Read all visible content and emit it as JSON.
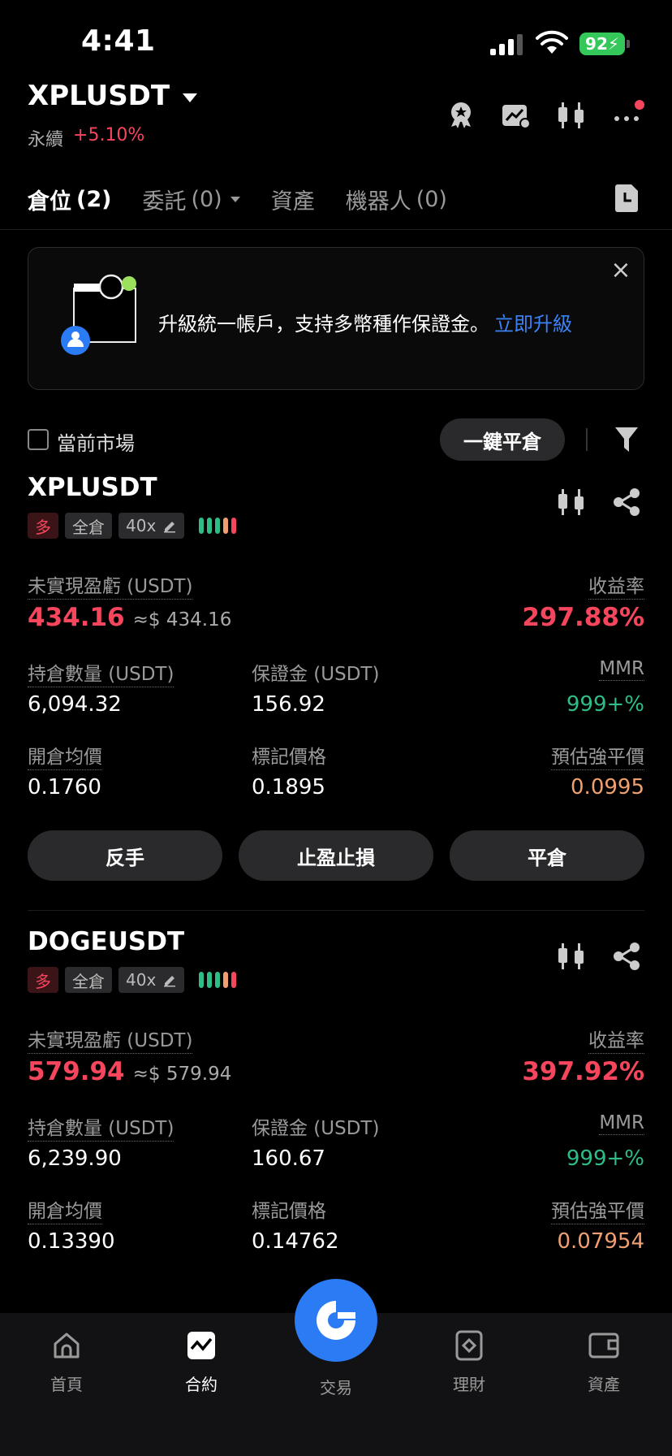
{
  "status_bar": {
    "time": "4:41",
    "battery": "92"
  },
  "header": {
    "symbol": "XPLUSDT",
    "contract_type": "永續",
    "change_pct": "+5.10%"
  },
  "tabs": [
    {
      "label": "倉位",
      "count": "(2)"
    },
    {
      "label": "委託",
      "count": "(0)"
    },
    {
      "label": "資產",
      "count": ""
    },
    {
      "label": "機器人",
      "count": "(0)"
    }
  ],
  "banner": {
    "text": "升級統一帳戶，支持多幣種作保證金。",
    "link": "立即升級",
    "close": "×"
  },
  "filter": {
    "current_market_label": "當前市場",
    "close_all_label": "一鍵平倉"
  },
  "positions": [
    {
      "symbol": "XPLUSDT",
      "side": "多",
      "margin_mode": "全倉",
      "leverage": "40x",
      "unrealized_label": "未實現盈虧 (USDT)",
      "unrealized_value": "434.16",
      "unrealized_approx": "≈$ 434.16",
      "roe_label": "收益率",
      "roe_value": "297.88%",
      "size_label": "持倉數量 (USDT)",
      "size_value": "6,094.32",
      "margin_label": "保證金 (USDT)",
      "margin_value": "156.92",
      "mmr_label": "MMR",
      "mmr_value": "999+%",
      "entry_label": "開倉均價",
      "entry_value": "0.1760",
      "mark_label": "標記價格",
      "mark_value": "0.1895",
      "liq_label": "預估強平價",
      "liq_value": "0.0995"
    },
    {
      "symbol": "DOGEUSDT",
      "side": "多",
      "margin_mode": "全倉",
      "leverage": "40x",
      "unrealized_label": "未實現盈虧 (USDT)",
      "unrealized_value": "579.94",
      "unrealized_approx": "≈$ 579.94",
      "roe_label": "收益率",
      "roe_value": "397.92%",
      "size_label": "持倉數量 (USDT)",
      "size_value": "6,239.90",
      "margin_label": "保證金 (USDT)",
      "margin_value": "160.67",
      "mmr_label": "MMR",
      "mmr_value": "999+%",
      "entry_label": "開倉均價",
      "entry_value": "0.13390",
      "mark_label": "標記價格",
      "mark_value": "0.14762",
      "liq_label": "預估強平價",
      "liq_value": "0.07954"
    }
  ],
  "actions": {
    "reverse": "反手",
    "tpsl": "止盈止損",
    "close": "平倉"
  },
  "nav": {
    "home": "首頁",
    "futures": "合約",
    "trade": "交易",
    "earn": "理財",
    "assets": "資產"
  },
  "colors": {
    "red": "#f6465d",
    "green": "#2ebd85",
    "orange": "#f0a070",
    "blue": "#2b7bf5"
  }
}
